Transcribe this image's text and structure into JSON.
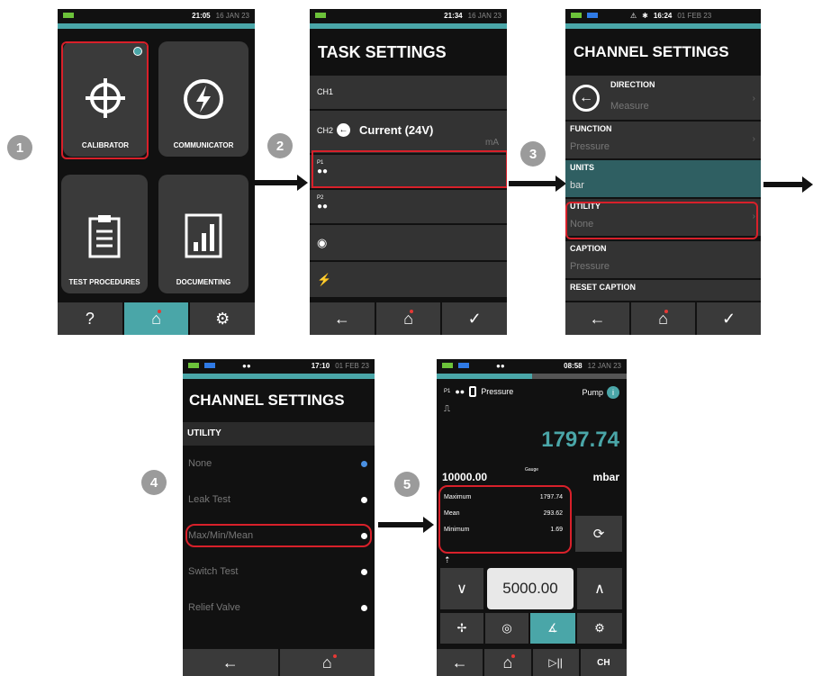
{
  "steps": [
    "1",
    "2",
    "3",
    "4",
    "5"
  ],
  "screen1": {
    "time": "21:05",
    "date": "16 JAN 23",
    "tiles": [
      "CALIBRATOR",
      "COMMUNICATOR",
      "TEST PROCEDURES",
      "DOCUMENTING"
    ]
  },
  "screen2": {
    "time": "21:34",
    "date": "16 JAN 23",
    "title": "TASK SETTINGS",
    "ch1": "CH1",
    "ch2": "CH2",
    "ch2_value": "Current (24V)",
    "ch2_unit": "mA",
    "p1": "P1",
    "p2": "P2"
  },
  "screen3": {
    "time": "16:24",
    "date": "01 FEB 23",
    "title": "CHANNEL SETTINGS",
    "rows": [
      {
        "label": "DIRECTION",
        "value": "Measure"
      },
      {
        "label": "FUNCTION",
        "value": "Pressure"
      },
      {
        "label": "UNITS",
        "value": "bar"
      },
      {
        "label": "UTILITY",
        "value": "None"
      },
      {
        "label": "CAPTION",
        "value": "Pressure"
      },
      {
        "label": "RESET CAPTION",
        "value": ""
      }
    ]
  },
  "screen4": {
    "time": "17:10",
    "date": "01 FEB 23",
    "title": "CHANNEL SETTINGS",
    "section": "UTILITY",
    "options": [
      "None",
      "Leak Test",
      "Max/Min/Mean",
      "Switch Test",
      "Relief Valve"
    ]
  },
  "screen5": {
    "time": "08:58",
    "date": "12 JAN 23",
    "p1": "P1",
    "function": "Pressure",
    "pump": "Pump",
    "reading": "1797.74",
    "range": "10000.00",
    "gauge": "Gauge",
    "unit": "mbar",
    "stats": [
      {
        "label": "Maximum",
        "value": "1797.74"
      },
      {
        "label": "Mean",
        "value": "293.62"
      },
      {
        "label": "Minimum",
        "value": "1.69"
      }
    ],
    "setpoint": "5000.00",
    "ch": "CH"
  },
  "colors": {
    "teal": "#4aa6a8",
    "highlight": "#d8202a",
    "panel": "#3a3a3a",
    "reading": "#4aa6a8"
  }
}
